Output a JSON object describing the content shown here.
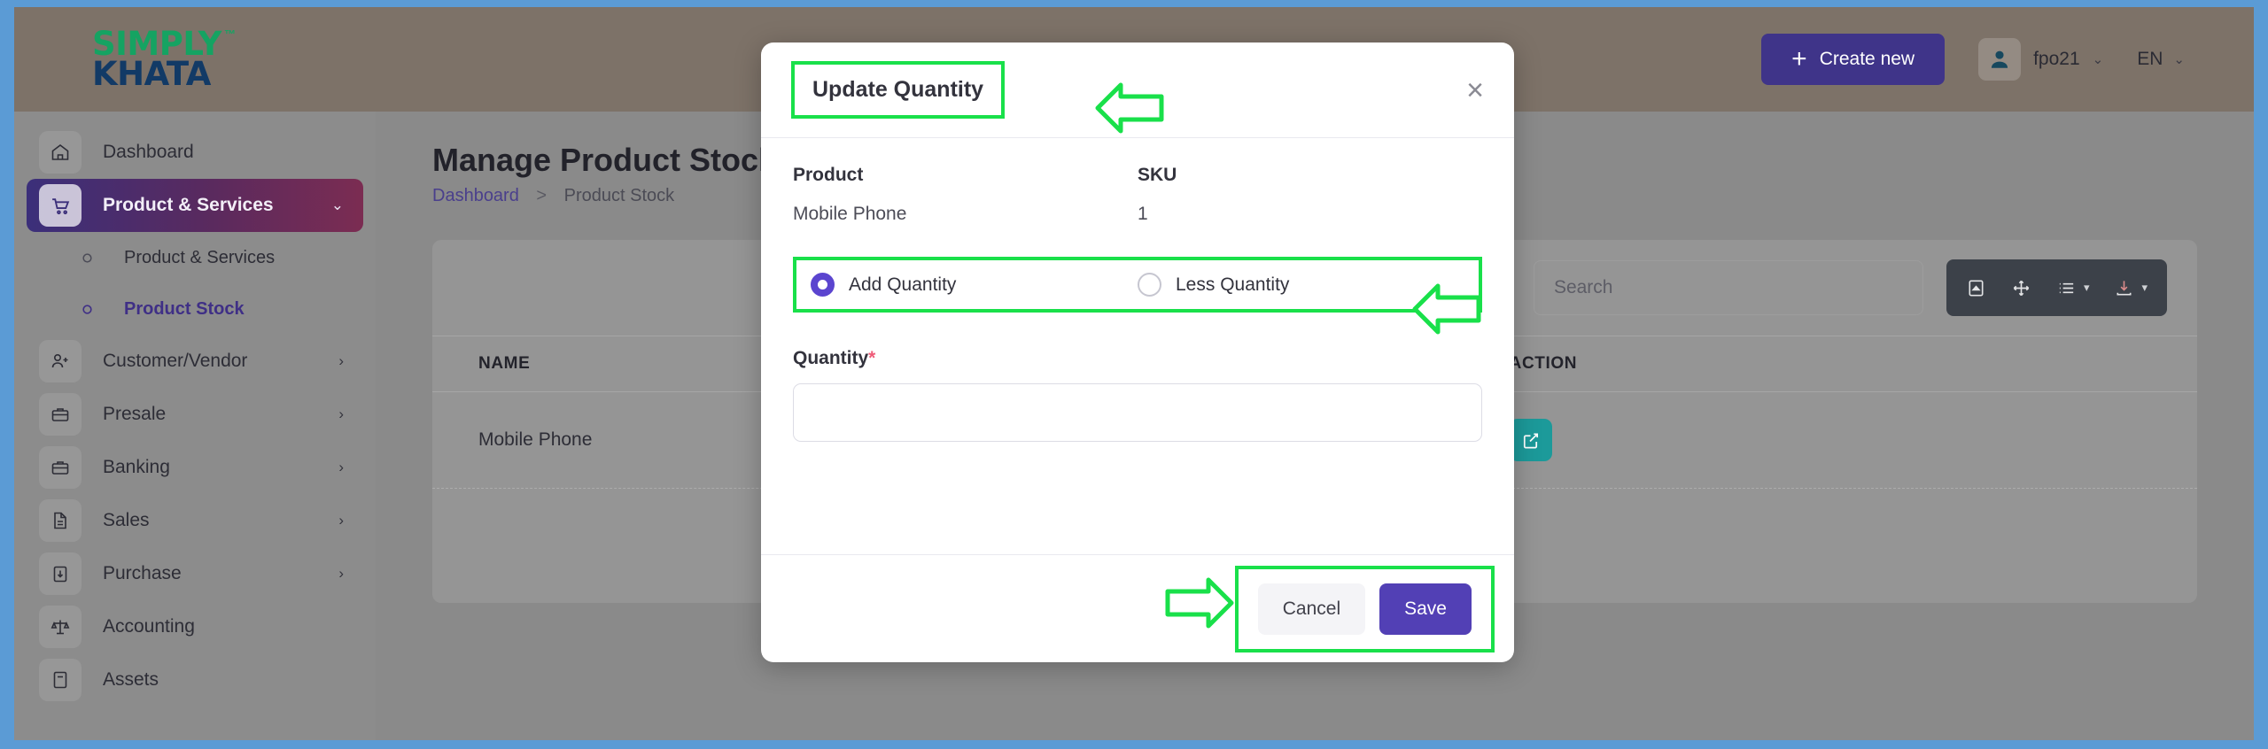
{
  "brand": {
    "logo_top": "SIMPLY",
    "logo_bottom": "KHATA",
    "trademark": "™",
    "green": "#15a362",
    "navy": "#123a66"
  },
  "topbar": {
    "create_new_label": "Create new",
    "user_name": "fpo21",
    "language": "EN",
    "background": "#7d7268",
    "create_new_color": "#3f3489"
  },
  "sidebar": {
    "items": [
      {
        "label": "Dashboard",
        "icon": "home-icon",
        "chevron": "",
        "state": "normal"
      },
      {
        "label": "Product & Services",
        "icon": "cart-icon",
        "chevron": "⌄",
        "state": "active"
      },
      {
        "label": "Customer/Vendor",
        "icon": "user-plus-icon",
        "chevron": "›",
        "state": "normal"
      },
      {
        "label": "Presale",
        "icon": "briefcase-icon",
        "chevron": "›",
        "state": "normal"
      },
      {
        "label": "Banking",
        "icon": "briefcase-icon",
        "chevron": "›",
        "state": "normal"
      },
      {
        "label": "Sales",
        "icon": "document-icon",
        "chevron": "›",
        "state": "normal"
      },
      {
        "label": "Purchase",
        "icon": "clipboard-icon",
        "chevron": "›",
        "state": "normal"
      },
      {
        "label": "Accounting",
        "icon": "scale-icon",
        "chevron": "",
        "state": "normal"
      },
      {
        "label": "Assets",
        "icon": "notebook-icon",
        "chevron": "",
        "state": "normal"
      }
    ],
    "subitems": [
      {
        "label": "Product & Services",
        "state": "normal"
      },
      {
        "label": "Product Stock",
        "state": "current"
      }
    ],
    "active_gradient": "#3b2f7a → #7b2c52"
  },
  "page": {
    "title": "Manage Product Stock",
    "breadcrumb": {
      "root": "Dashboard",
      "separator": ">",
      "current": "Product Stock"
    }
  },
  "toolbar": {
    "search_placeholder": "Search",
    "search_value": "",
    "buttons": [
      {
        "name": "collapse-icon",
        "caret": false
      },
      {
        "name": "fullscreen-icon",
        "caret": false
      },
      {
        "name": "columns-icon",
        "caret": true
      },
      {
        "name": "export-icon",
        "caret": true
      }
    ],
    "background": "#3c4149"
  },
  "table": {
    "columns": [
      "NAME",
      "ACTION"
    ],
    "rows": [
      {
        "name": "Mobile Phone",
        "action_icon": "edit-icon",
        "action_color": "#1c9a9a"
      }
    ]
  },
  "modal": {
    "title": "Update Quantity",
    "close_icon": "×",
    "product_label": "Product",
    "sku_label": "SKU",
    "product_value": "Mobile Phone",
    "sku_value": "1",
    "radio_options": [
      {
        "label": "Add Quantity",
        "checked": true
      },
      {
        "label": "Less Quantity",
        "checked": false
      }
    ],
    "quantity_label": "Quantity",
    "required_marker": "*",
    "quantity_value": "",
    "quantity_placeholder": "",
    "cancel_label": "Cancel",
    "save_label": "Save",
    "save_color": "#5240b5",
    "radio_checked_color": "#5b45cf"
  },
  "annotations": {
    "highlight_color": "#19e04a",
    "boxes": [
      "modal-title",
      "radio-group",
      "footer-buttons"
    ],
    "arrows": [
      {
        "target": "modal-title",
        "direction": "left"
      },
      {
        "target": "radio-group",
        "direction": "left"
      },
      {
        "target": "footer-buttons",
        "direction": "right"
      }
    ]
  }
}
